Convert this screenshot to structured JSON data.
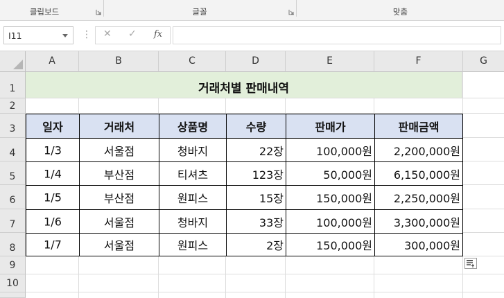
{
  "ribbon": {
    "groups": [
      {
        "label": "클립보드"
      },
      {
        "label": "글꼴"
      },
      {
        "label": "맞춤"
      }
    ]
  },
  "formula_bar": {
    "name_box": "I11",
    "cancel_icon": "✕",
    "enter_icon": "✓",
    "fx_label": "fx",
    "content": ""
  },
  "columns": [
    "A",
    "B",
    "C",
    "D",
    "E",
    "F",
    "G"
  ],
  "rows": [
    "1",
    "2",
    "3",
    "4",
    "5",
    "6",
    "7",
    "8",
    "9",
    "10"
  ],
  "sheet": {
    "title": "거래처별 판매내역",
    "headers": [
      "일자",
      "거래처",
      "상품명",
      "수량",
      "판매가",
      "판매금액"
    ],
    "records": [
      {
        "date": "1/3",
        "client": "서울점",
        "product": "청바지",
        "qty": "22장",
        "price": "100,000원",
        "amount": "2,200,000원"
      },
      {
        "date": "1/4",
        "client": "부산점",
        "product": "티셔츠",
        "qty": "123장",
        "price": "50,000원",
        "amount": "6,150,000원"
      },
      {
        "date": "1/5",
        "client": "부산점",
        "product": "원피스",
        "qty": "15장",
        "price": "150,000원",
        "amount": "2,250,000원"
      },
      {
        "date": "1/6",
        "client": "서울점",
        "product": "청바지",
        "qty": "33장",
        "price": "100,000원",
        "amount": "3,300,000원"
      },
      {
        "date": "1/7",
        "client": "서울점",
        "product": "원피스",
        "qty": "2장",
        "price": "150,000원",
        "amount": "300,000원"
      }
    ]
  },
  "colors": {
    "title_fill": "#e2efda",
    "header_fill": "#d9e1f2",
    "grid_line": "#dcdcdc",
    "header_bg": "#e9e9e9"
  }
}
